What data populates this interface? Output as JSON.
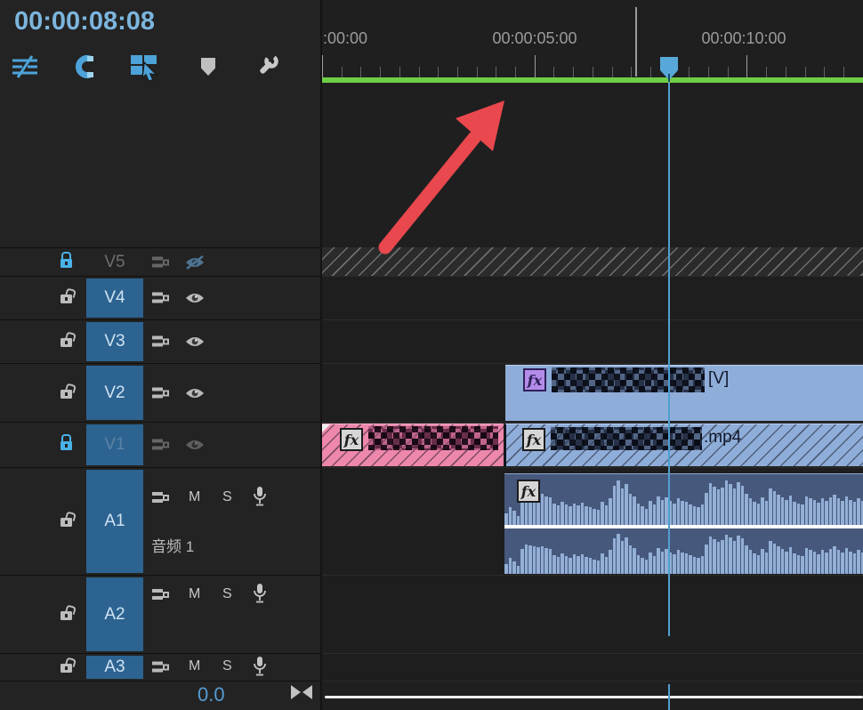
{
  "playback": {
    "timecode": "00:00:08:08"
  },
  "toolbar": {
    "icons": [
      "sequence-as-nest-icon",
      "snap-icon",
      "linked-selection-icon",
      "add-marker-icon",
      "timeline-settings-icon"
    ]
  },
  "ruler": {
    "labels": [
      ":00:00",
      "00:00:05:00",
      "00:00:10:00"
    ]
  },
  "video_tracks": [
    {
      "id": "V5",
      "locked": true,
      "hidden": true,
      "targeted": false
    },
    {
      "id": "V4",
      "locked": false,
      "hidden": false,
      "targeted": true
    },
    {
      "id": "V3",
      "locked": false,
      "hidden": false,
      "targeted": true
    },
    {
      "id": "V2",
      "locked": false,
      "hidden": false,
      "targeted": true
    },
    {
      "id": "V1",
      "locked": true,
      "hidden": false,
      "targeted": true
    }
  ],
  "audio_tracks": [
    {
      "id": "A1",
      "name": "音频 1",
      "mute_label": "M",
      "solo_label": "S"
    },
    {
      "id": "A2",
      "mute_label": "M",
      "solo_label": "S"
    },
    {
      "id": "A3",
      "mute_label": "M",
      "solo_label": "S"
    }
  ],
  "clips": {
    "fx_label": "fx",
    "v2_clip": {
      "censored": true,
      "suffix": "[V]"
    },
    "v1_pink_clip": {
      "censored": true,
      "suffix": ""
    },
    "v1_blue_clip": {
      "censored": true,
      "suffix": ".mp4"
    }
  },
  "footer": {
    "meter_value": "0.0"
  },
  "waveform": {
    "amplitudes": [
      0.22,
      0.35,
      0.28,
      0.18,
      0.55,
      0.65,
      0.62,
      0.6,
      0.58,
      0.61,
      0.57,
      0.55,
      0.42,
      0.38,
      0.45,
      0.4,
      0.36,
      0.43,
      0.39,
      0.44,
      0.37,
      0.35,
      0.32,
      0.3,
      0.46,
      0.38,
      0.52,
      0.78,
      0.88,
      0.72,
      0.8,
      0.62,
      0.57,
      0.42,
      0.36,
      0.32,
      0.47,
      0.4,
      0.56,
      0.5,
      0.54,
      0.47,
      0.43,
      0.52,
      0.48,
      0.45,
      0.41,
      0.37,
      0.35,
      0.4,
      0.64,
      0.82,
      0.76,
      0.7,
      0.74,
      0.87,
      0.8,
      0.72,
      0.84,
      0.78,
      0.62,
      0.52,
      0.46,
      0.42,
      0.54,
      0.48,
      0.72,
      0.66,
      0.6,
      0.54,
      0.5,
      0.58,
      0.46,
      0.42,
      0.4,
      0.57,
      0.52,
      0.5,
      0.44,
      0.52,
      0.47,
      0.55,
      0.6,
      0.52,
      0.48,
      0.56,
      0.5,
      0.46,
      0.52,
      0.48
    ]
  },
  "colors": {
    "timecode_blue": "#7cb5dd",
    "toolbar_blue": "#4da3d9",
    "track_header_blue": "#2c6391",
    "clip_blue": "#8fadd9",
    "clip_pink": "#ee87ac",
    "audio_clip": "#46587c",
    "waveform": "#93afd6",
    "render_bar_green": "#6fce45",
    "playhead_blue": "#4f9fd0",
    "annotation_red": "#e8484e"
  }
}
